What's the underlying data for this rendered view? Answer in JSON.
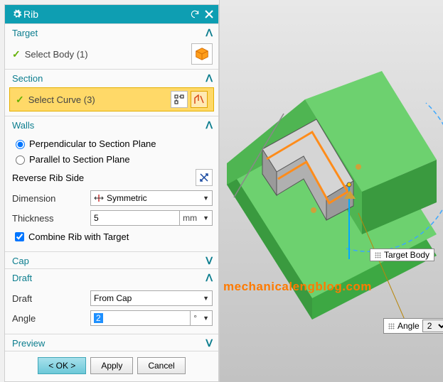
{
  "header": {
    "title": "Rib"
  },
  "target_group": {
    "title": "Target",
    "select_label": "Select Body (1)"
  },
  "section_group": {
    "title": "Section",
    "select_label": "Select Curve (3)"
  },
  "walls_group": {
    "title": "Walls",
    "radio_perpendicular": "Perpendicular to Section Plane",
    "radio_parallel": "Parallel to Section Plane",
    "reverse_label": "Reverse Rib Side",
    "dimension_label": "Dimension",
    "dimension_value": "Symmetric",
    "thickness_label": "Thickness",
    "thickness_value": "5",
    "thickness_unit": "mm",
    "combine_label": "Combine Rib with Target"
  },
  "cap_group": {
    "title": "Cap"
  },
  "draft_group": {
    "title": "Draft",
    "draft_label": "Draft",
    "draft_value": "From Cap",
    "angle_label": "Angle",
    "angle_value": "2",
    "angle_unit": "°"
  },
  "preview_group": {
    "title": "Preview"
  },
  "buttons": {
    "ok": "< OK >",
    "apply": "Apply",
    "cancel": "Cancel"
  },
  "viewport": {
    "target_body_tip": "Target Body",
    "angle_tip_label": "Angle",
    "angle_tip_value": "2",
    "watermark": "mechanicalengblog.com"
  }
}
